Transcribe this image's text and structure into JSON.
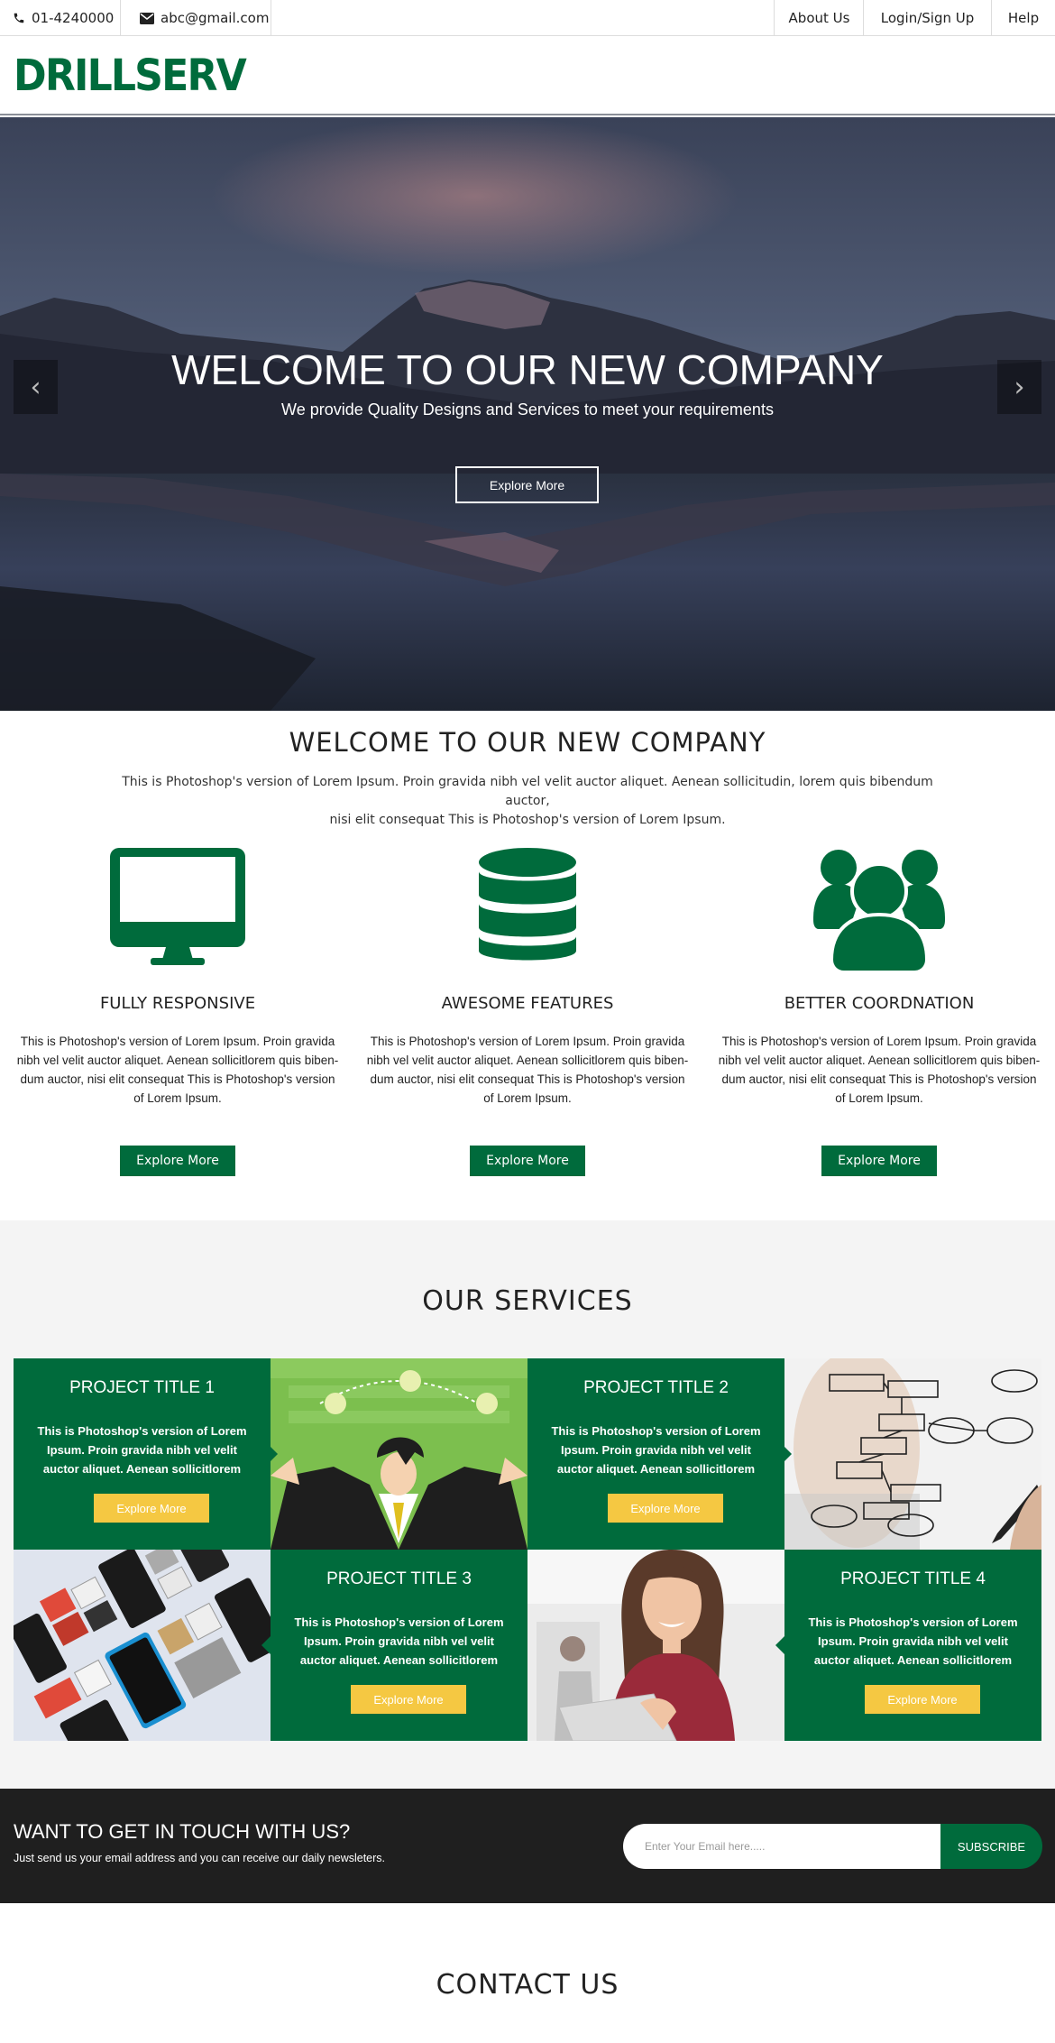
{
  "topbar": {
    "phone": "01-4240000",
    "email": "abc@gmail.com",
    "nav": [
      "About Us",
      "Login/Sign Up",
      "Help"
    ]
  },
  "logo": {
    "text": "DRILLSERV"
  },
  "hero": {
    "title": "WELCOME TO OUR NEW COMPANY",
    "subtitle": "We provide Quality Designs and Services to meet your requirements",
    "button": "Explore More",
    "prev_icon": "chevron-left-icon",
    "next_icon": "chevron-right-icon"
  },
  "welcome": {
    "title": "WELCOME TO OUR NEW COMPANY",
    "text_line1": "This is Photoshop's version  of Lorem Ipsum. Proin gravida nibh vel velit auctor aliquet. Aenean sollicitudin, lorem quis bibendum auctor,",
    "text_line2": "nisi elit consequat This is Photoshop's version  of Lorem Ipsum."
  },
  "features": [
    {
      "icon": "monitor-icon",
      "title": "FULLY RESPONSIVE",
      "text": "This is Photoshop's version  of Lorem Ipsum. Proin gravida nibh vel velit auctor aliquet. Aenean sollicitlorem quis biben-dum auctor, nisi elit consequat This is Photoshop's version  of Lorem Ipsum.",
      "button": "Explore More"
    },
    {
      "icon": "database-icon",
      "title": "AWESOME FEATURES",
      "text": "This is Photoshop's version  of Lorem Ipsum. Proin gravida nibh vel velit auctor aliquet. Aenean sollicitlorem quis biben-dum auctor, nisi elit consequat This is Photoshop's version  of Lorem Ipsum.",
      "button": "Explore More"
    },
    {
      "icon": "users-icon",
      "title": "BETTER COORDNATION",
      "text": "This is Photoshop's version  of Lorem Ipsum. Proin gravida nibh vel velit auctor aliquet. Aenean sollicitlorem quis biben-dum auctor, nisi elit consequat This is Photoshop's version  of Lorem Ipsum.",
      "button": "Explore More"
    }
  ],
  "services": {
    "title": "OUR SERVICES",
    "projects": [
      {
        "title": "PROJECT TITLE 1",
        "text": "This is Photoshop's version  of Lorem Ipsum. Proin gravida nibh vel velit auctor aliquet. Aenean sollicitlorem",
        "button": "Explore More"
      },
      {
        "title": "PROJECT TITLE 2",
        "text": "This is Photoshop's version  of Lorem Ipsum. Proin gravida nibh vel velit auctor aliquet. Aenean sollicitlorem",
        "button": "Explore More"
      },
      {
        "title": "PROJECT TITLE 3",
        "text": "This is Photoshop's version  of Lorem Ipsum. Proin gravida nibh vel velit auctor aliquet. Aenean sollicitlorem",
        "button": "Explore More"
      },
      {
        "title": "PROJECT TITLE 4",
        "text": "This is Photoshop's version  of Lorem Ipsum. Proin gravida nibh vel velit auctor aliquet. Aenean sollicitlorem",
        "button": "Explore More"
      }
    ]
  },
  "newsletter": {
    "title": "WANT TO GET IN TOUCH WITH US?",
    "subtitle": "Just send us your email address and you can receive our daily newsleters.",
    "placeholder": "Enter Your Email here.....",
    "button": "SUBSCRIBE"
  },
  "contact": {
    "title": "CONTACT US"
  },
  "colors": {
    "brand": "#006b3c",
    "accent": "#f5c842",
    "dark": "#1f1f1f"
  }
}
